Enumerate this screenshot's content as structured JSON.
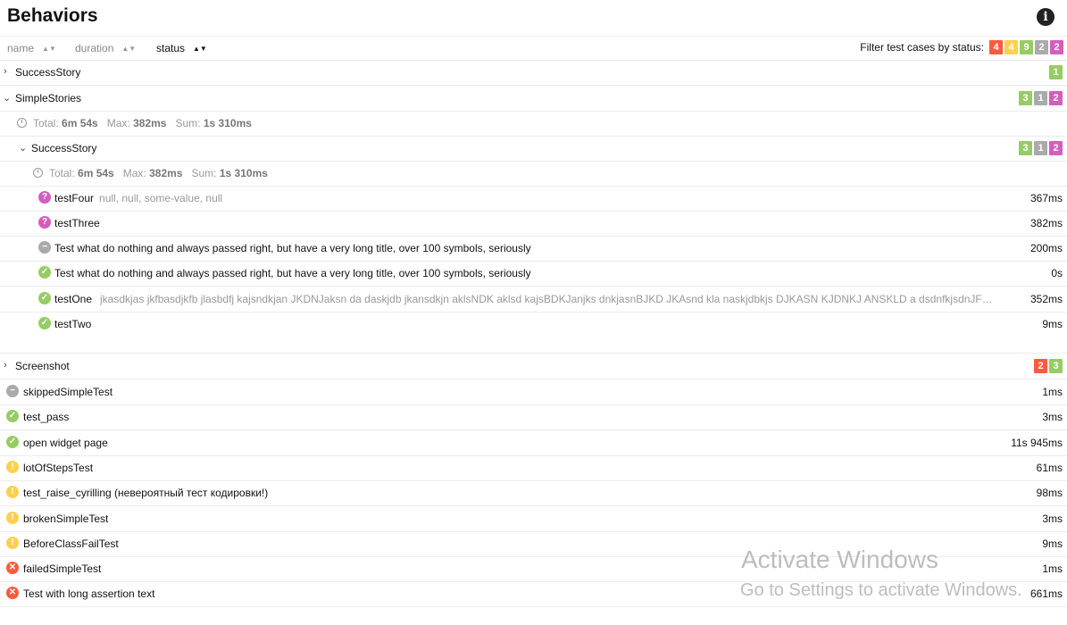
{
  "header": {
    "title": "Behaviors",
    "info_icon": "info-icon"
  },
  "sort": {
    "name": "name",
    "duration": "duration",
    "status": "status"
  },
  "filter": {
    "label": "Filter test cases by status:",
    "counts": {
      "failed": "4",
      "broken": "4",
      "passed": "9",
      "skipped": "2",
      "unknown": "2"
    }
  },
  "colors": {
    "failed": "#fd5a3e",
    "broken": "#ffd050",
    "passed": "#97cc64",
    "skipped": "#aaaaaa",
    "unknown": "#d35ebe"
  },
  "groups": {
    "success_story": {
      "name": "SuccessStory",
      "badges": {
        "passed": "1"
      }
    },
    "simple_stories": {
      "name": "SimpleStories",
      "badges": {
        "passed": "3",
        "skipped": "1",
        "unknown": "2"
      },
      "stats": {
        "total_label": "Total:",
        "total": "6m 54s",
        "max_label": "Max:",
        "max": "382ms",
        "sum_label": "Sum:",
        "sum": "1s 310ms"
      },
      "child": {
        "name": "SuccessStory",
        "badges": {
          "passed": "3",
          "skipped": "1",
          "unknown": "2"
        },
        "stats": {
          "total_label": "Total:",
          "total": "6m 54s",
          "max_label": "Max:",
          "max": "382ms",
          "sum_label": "Sum:",
          "sum": "1s 310ms"
        },
        "tests": [
          {
            "status_icon": "unknown-icon",
            "name": "testFour",
            "params": "null, null, some-value, null",
            "duration": "367ms"
          },
          {
            "status_icon": "unknown-icon",
            "name": "testThree",
            "params": "",
            "duration": "382ms"
          },
          {
            "status_icon": "skipped-icon",
            "name": "Test what do nothing and always passed right, but have a very long title, over 100 symbols, seriously",
            "params": "",
            "duration": "200ms"
          },
          {
            "status_icon": "passed-icon",
            "name": "Test what do nothing and always passed right, but have a very long title, over 100 symbols, seriously",
            "params": "",
            "duration": "0s"
          },
          {
            "status_icon": "passed-icon",
            "name": "testOne",
            "params": "jkasdkjas jkfbasdjkfb jlasbdfj kajsndkjan JKDNJaksn da daskjdb jkansdkjn aklsNDK aklsd kajsBDKJanjks dnkjasnBJKD JKAsnd kla naskjdbkjs DJKASN KJDNKJ ANSKLD a dsdnfkjsdnJF…",
            "duration": "352ms"
          },
          {
            "status_icon": "passed-icon",
            "name": "testTwo",
            "params": "",
            "duration": "9ms"
          }
        ]
      }
    },
    "screenshot": {
      "name": "Screenshot",
      "badges": {
        "failed": "2",
        "passed": "3"
      }
    }
  },
  "tests": [
    {
      "status_icon": "skipped-icon",
      "name": "skippedSimpleTest",
      "duration": "1ms"
    },
    {
      "status_icon": "passed-icon",
      "name": "test_pass",
      "duration": "3ms"
    },
    {
      "status_icon": "passed-icon",
      "name": "open widget page",
      "duration": "11s 945ms"
    },
    {
      "status_icon": "broken-icon",
      "name": "lotOfStepsTest",
      "duration": "61ms"
    },
    {
      "status_icon": "broken-icon",
      "name": "test_raise_cyrilling (невероятный тест кодировки!)",
      "duration": "98ms"
    },
    {
      "status_icon": "broken-icon",
      "name": "brokenSimpleTest",
      "duration": "3ms"
    },
    {
      "status_icon": "broken-icon",
      "name": "BeforeClassFailTest",
      "duration": "9ms"
    },
    {
      "status_icon": "failed-icon",
      "name": "failedSimpleTest",
      "duration": "1ms"
    },
    {
      "status_icon": "failed-icon",
      "name": "Test with long assertion text",
      "duration": "661ms"
    }
  ],
  "watermark": {
    "line1": "Activate Windows",
    "line2": "Go to Settings to activate Windows."
  }
}
